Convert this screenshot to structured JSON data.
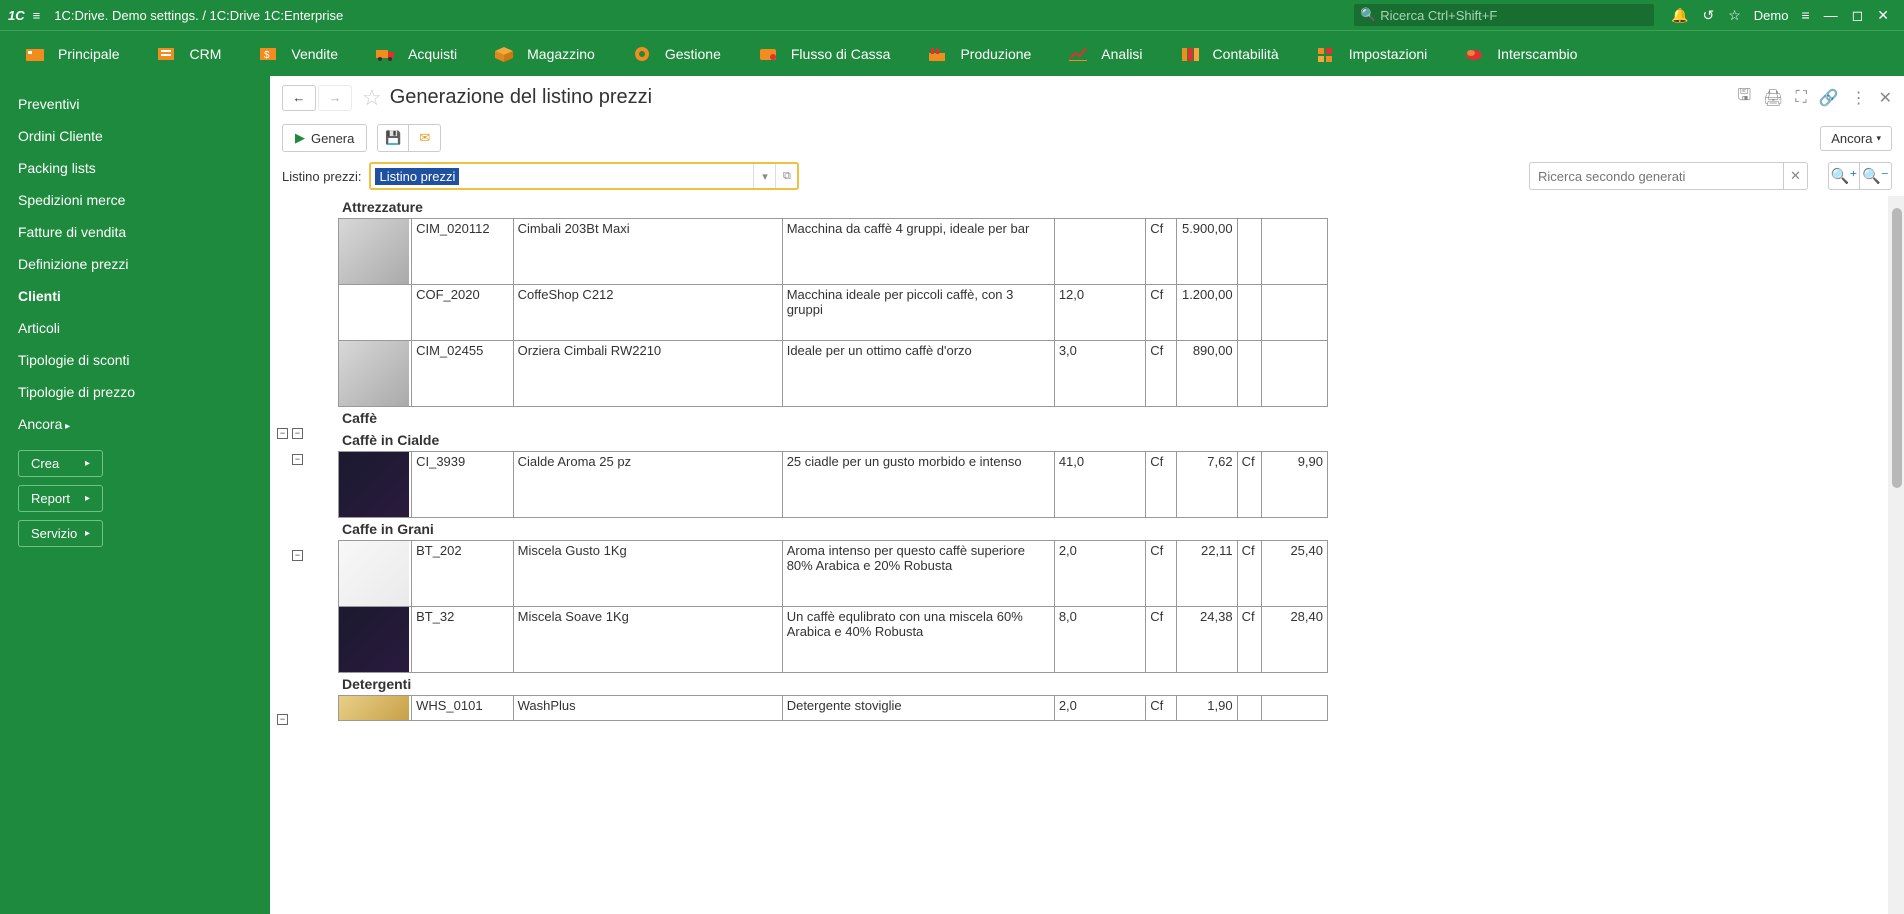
{
  "titlebar": {
    "app_title": "1C:Drive. Demo settings. / 1C:Drive 1C:Enterprise",
    "search_placeholder": "Ricerca Ctrl+Shift+F",
    "user": "Demo"
  },
  "navbar": {
    "items": [
      {
        "label": "Principale"
      },
      {
        "label": "CRM"
      },
      {
        "label": "Vendite"
      },
      {
        "label": "Acquisti"
      },
      {
        "label": "Magazzino"
      },
      {
        "label": "Gestione"
      },
      {
        "label": "Flusso di Cassa"
      },
      {
        "label": "Produzione"
      },
      {
        "label": "Analisi"
      },
      {
        "label": "Contabilità"
      },
      {
        "label": "Impostazioni"
      },
      {
        "label": "Interscambio"
      }
    ]
  },
  "sidebar": {
    "links": [
      {
        "label": "Preventivi"
      },
      {
        "label": "Ordini Cliente"
      },
      {
        "label": "Packing lists"
      },
      {
        "label": "Spedizioni merce"
      },
      {
        "label": "Fatture di vendita"
      },
      {
        "label": "Definizione prezzi"
      },
      {
        "label": "Clienti",
        "active": true
      },
      {
        "label": "Articoli"
      },
      {
        "label": "Tipologie di sconti"
      },
      {
        "label": "Tipologie di prezzo"
      },
      {
        "label": "Ancora",
        "expand": true
      }
    ],
    "buttons": [
      {
        "label": "Crea"
      },
      {
        "label": "Report"
      },
      {
        "label": "Servizio"
      }
    ]
  },
  "content": {
    "title": "Generazione del listino prezzi",
    "generate_label": "Genera",
    "ancora_label": "Ancora",
    "filter_label": "Listino prezzi:",
    "filter_value": "Listino prezzi",
    "search2_placeholder": "Ricerca secondo generati"
  },
  "groups": {
    "attrezzature": "Attrezzature",
    "caffe": "Caffè",
    "caffe_cialde": "Caffè in Cialde",
    "caffe_grani": "Caffe in Grani",
    "detergenti": "Detergenti"
  },
  "rows": {
    "r1": {
      "code": "CIM_020112",
      "name": "Cimbali 203Bt Maxi",
      "desc": "Macchina da caffè 4 gruppi, ideale per bar",
      "qty": "",
      "unit": "Cf",
      "p1": "5.900,00",
      "u2": "",
      "p2": ""
    },
    "r2": {
      "code": "COF_2020",
      "name": "CoffeShop C212",
      "desc": "Macchina ideale per piccoli caffè, con 3 gruppi",
      "qty": "12,0",
      "unit": "Cf",
      "p1": "1.200,00",
      "u2": "",
      "p2": ""
    },
    "r3": {
      "code": "CIM_02455",
      "name": "Orziera Cimbali RW2210",
      "desc": "Ideale per un ottimo caffè d'orzo",
      "qty": "3,0",
      "unit": "Cf",
      "p1": "890,00",
      "u2": "",
      "p2": ""
    },
    "r4": {
      "code": "CI_3939",
      "name": "Cialde Aroma 25 pz",
      "desc": "25 ciadle per un gusto morbido e intenso",
      "qty": "41,0",
      "unit": "Cf",
      "p1": "7,62",
      "u2": "Cf",
      "p2": "9,90"
    },
    "r5": {
      "code": "BT_202",
      "name": "Miscela Gusto 1Kg",
      "desc": "Aroma intenso per questo caffè superiore 80% Arabica e 20% Robusta",
      "qty": "2,0",
      "unit": "Cf",
      "p1": "22,11",
      "u2": "Cf",
      "p2": "25,40"
    },
    "r6": {
      "code": "BT_32",
      "name": "Miscela Soave 1Kg",
      "desc": "Un caffè equlibrato con una miscela 60% Arabica e 40% Robusta",
      "qty": "8,0",
      "unit": "Cf",
      "p1": "24,38",
      "u2": "Cf",
      "p2": "28,40"
    },
    "r7": {
      "code": "WHS_0101",
      "name": "WashPlus",
      "desc": "Detergente stoviglie",
      "qty": "2,0",
      "unit": "Cf",
      "p1": "1,90",
      "u2": "",
      "p2": ""
    }
  }
}
